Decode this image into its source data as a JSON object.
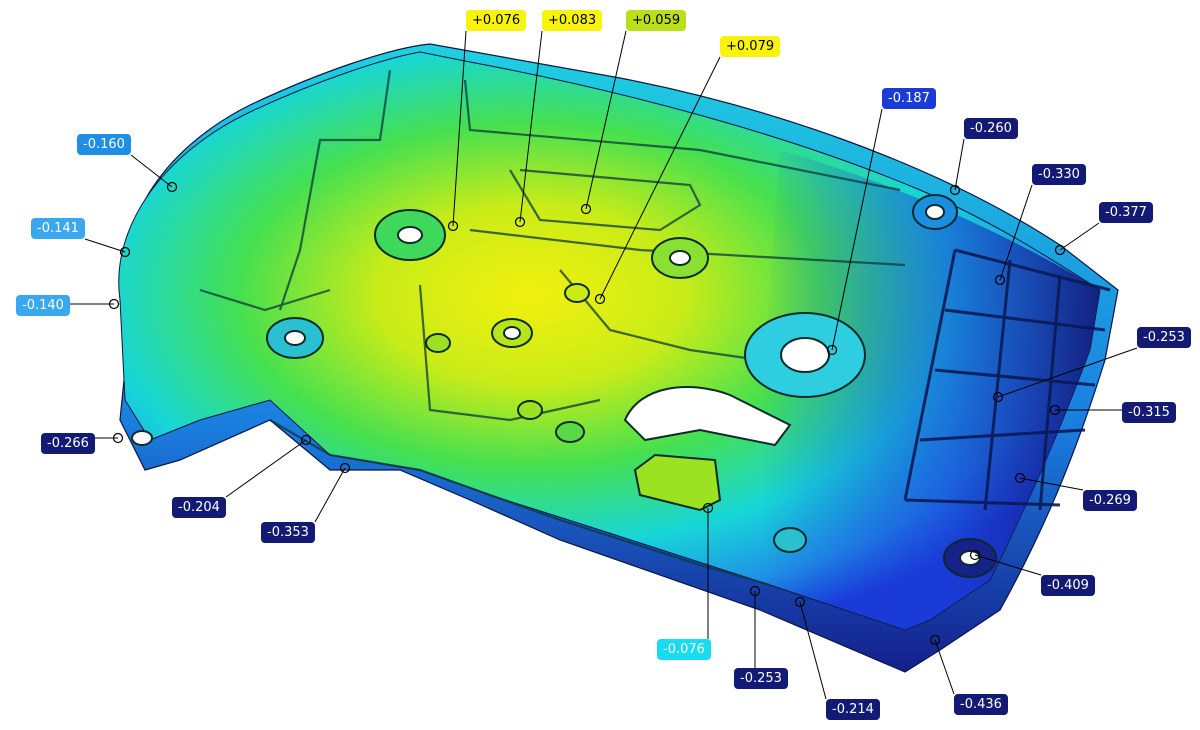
{
  "view": {
    "title": "",
    "colors": {
      "deep_negative": "#121a73",
      "negative": "#1a3bd8",
      "mid_negative": "#1f8fe6",
      "light_negative": "#3aa8ee",
      "near_zero": "#19dcf0",
      "positive_low": "#b9e01a",
      "positive": "#f8f30a"
    }
  },
  "callouts": [
    {
      "id": "d01",
      "label": "+0.076",
      "band": "positive"
    },
    {
      "id": "d02",
      "label": "+0.083",
      "band": "positive"
    },
    {
      "id": "d03",
      "label": "+0.059",
      "band": "positive_low"
    },
    {
      "id": "d04",
      "label": "+0.079",
      "band": "positive"
    },
    {
      "id": "d05",
      "label": "-0.187",
      "band": "negative"
    },
    {
      "id": "d06",
      "label": "-0.260",
      "band": "deep_negative"
    },
    {
      "id": "d07",
      "label": "-0.330",
      "band": "deep_negative"
    },
    {
      "id": "d08",
      "label": "-0.377",
      "band": "deep_negative"
    },
    {
      "id": "d09",
      "label": "-0.160",
      "band": "mid_negative"
    },
    {
      "id": "d10",
      "label": "-0.141",
      "band": "light_negative"
    },
    {
      "id": "d11",
      "label": "-0.140",
      "band": "light_negative"
    },
    {
      "id": "d12",
      "label": "-0.253",
      "band": "deep_negative"
    },
    {
      "id": "d13",
      "label": "-0.315",
      "band": "deep_negative"
    },
    {
      "id": "d14",
      "label": "-0.266",
      "band": "deep_negative"
    },
    {
      "id": "d15",
      "label": "-0.204",
      "band": "deep_negative"
    },
    {
      "id": "d16",
      "label": "-0.353",
      "band": "deep_negative"
    },
    {
      "id": "d17",
      "label": "-0.269",
      "band": "deep_negative"
    },
    {
      "id": "d18",
      "label": "-0.409",
      "band": "deep_negative"
    },
    {
      "id": "d19",
      "label": "-0.076",
      "band": "near_zero"
    },
    {
      "id": "d20",
      "label": "-0.253",
      "band": "deep_negative"
    },
    {
      "id": "d21",
      "label": "-0.214",
      "band": "deep_negative"
    },
    {
      "id": "d22",
      "label": "-0.436",
      "band": "deep_negative"
    }
  ]
}
